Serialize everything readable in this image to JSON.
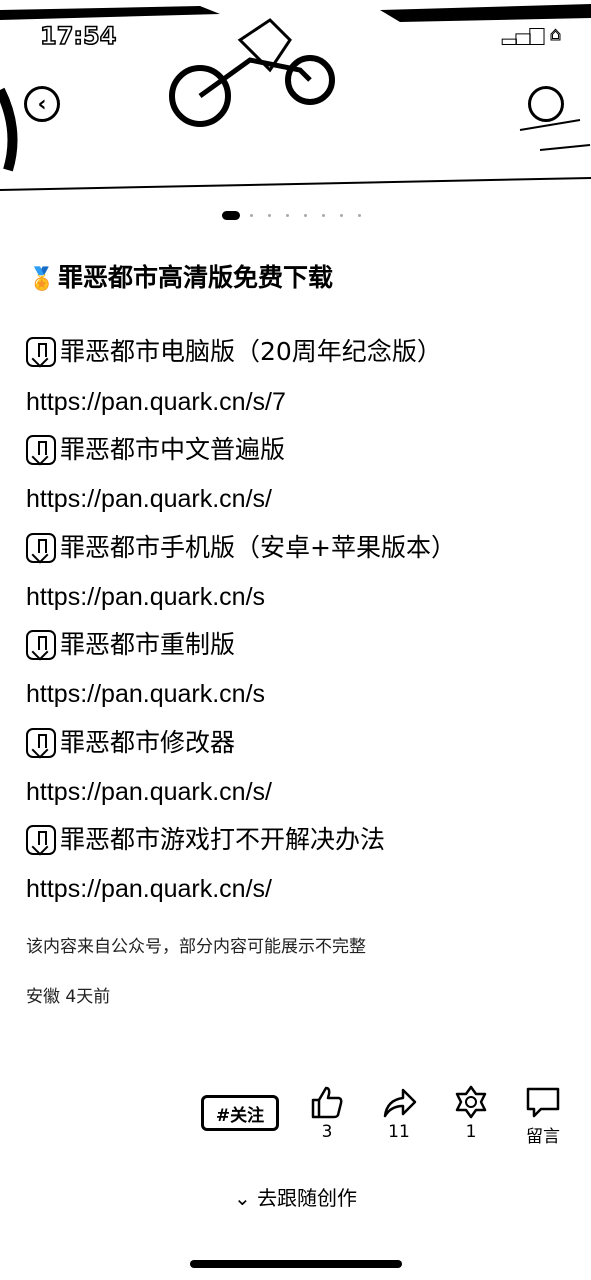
{
  "status_bar": {
    "time": "17:54"
  },
  "carousel": {
    "total": 8,
    "active": 0
  },
  "article": {
    "title": "罪恶都市高清版免费下载",
    "items": [
      {
        "label": "罪恶都市电脑版（20周年纪念版）",
        "url": "https://pan.quark.cn/s/7"
      },
      {
        "label": "罪恶都市中文普遍版",
        "url": "https://pan.quark.cn/s/"
      },
      {
        "label": "罪恶都市手机版（安卓+苹果版本）",
        "url": "https://pan.quark.cn/s"
      },
      {
        "label": "罪恶都市重制版",
        "url": "https://pan.quark.cn/s"
      },
      {
        "label": "罪恶都市修改器",
        "url": "https://pan.quark.cn/s/"
      },
      {
        "label": "罪恶都市游戏打不开解决办法",
        "url": "https://pan.quark.cn/s/"
      }
    ],
    "source_note": "该内容来自公众号，部分内容可能展示不完整",
    "meta": "安徽 4天前"
  },
  "actions": {
    "follow_label": "#关注",
    "like_count": "3",
    "share_count": "11",
    "favorite_count": "1",
    "comment_label": "留言"
  },
  "footer": {
    "follow_create": "去跟随创作"
  },
  "icons": [
    "back-icon",
    "download-icon",
    "medal-icon",
    "thumbs-up-icon",
    "share-icon",
    "star-icon",
    "comment-icon",
    "chevron-down-icon"
  ]
}
